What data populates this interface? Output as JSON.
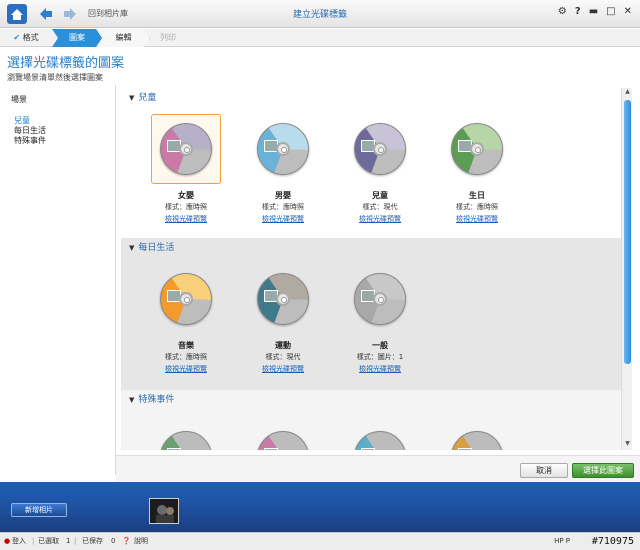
{
  "app": {
    "title": "建立光碟標籤",
    "back_label": "回到相片庫"
  },
  "top_icons": [
    {
      "name": "gear-icon",
      "glyph": "⚙"
    },
    {
      "name": "help-icon",
      "glyph": "?"
    },
    {
      "name": "minimize-icon",
      "glyph": "▬"
    },
    {
      "name": "maximize-icon",
      "glyph": "□"
    },
    {
      "name": "close-icon",
      "glyph": "✕"
    }
  ],
  "steps": {
    "format": "格式",
    "design": "圖案",
    "edit": "編輯",
    "print": "列印"
  },
  "heading": {
    "title": "選擇光碟標籤的圖案",
    "subtitle": "瀏覽場景清單然後選擇圖案"
  },
  "sidebar": {
    "section": "場景",
    "items": [
      "兒童",
      "每日生活",
      "特殊事件"
    ]
  },
  "groups": [
    {
      "title": "兒童",
      "cards": [
        {
          "name": "女嬰",
          "style": "樣式：應時照",
          "link": "檢視光碟預覽",
          "colors": [
            "#c97aa6",
            "#b6b0c8"
          ]
        },
        {
          "name": "男嬰",
          "style": "樣式：應時照",
          "link": "檢視光碟預覽",
          "colors": [
            "#6bb2d9",
            "#b8dcec"
          ]
        },
        {
          "name": "兒童",
          "style": "樣式：現代",
          "link": "檢視光碟預覽",
          "colors": [
            "#6e6a9c",
            "#c9c3d8"
          ]
        },
        {
          "name": "生日",
          "style": "樣式：應時照",
          "link": "檢視光碟預覽",
          "colors": [
            "#5c9c55",
            "#b6d6a8"
          ]
        }
      ]
    },
    {
      "title": "每日生活",
      "cards": [
        {
          "name": "音樂",
          "style": "樣式：應時照",
          "link": "檢視光碟預覽",
          "colors": [
            "#f39a2c",
            "#f8d07a"
          ]
        },
        {
          "name": "運動",
          "style": "樣式：現代",
          "link": "檢視光碟預覽",
          "colors": [
            "#3f7a8a",
            "#b0aaa0"
          ]
        },
        {
          "name": "一般",
          "style": "樣式：圖片：1",
          "link": "檢視光碟預覽",
          "colors": [
            "#a8a8a8",
            "#c8c8c8"
          ]
        }
      ]
    },
    {
      "title": "特殊事件",
      "cards": [
        {
          "colors": [
            "#6aa070",
            "#bcbcbc"
          ]
        },
        {
          "colors": [
            "#c97aa6",
            "#bcbcbc"
          ]
        },
        {
          "colors": [
            "#5bb0c8",
            "#bcbcbc"
          ]
        },
        {
          "colors": [
            "#d8a040",
            "#bcbcbc"
          ]
        }
      ]
    }
  ],
  "actions": {
    "cancel": "取消",
    "select": "選擇此圖案"
  },
  "tray": {
    "add_photos": "新增相片"
  },
  "status": {
    "login": "登入",
    "received": "已選取",
    "received_count": "1",
    "saved": "已保存",
    "saved_count": "0",
    "help": "說明",
    "brand": "HP P",
    "watermark": "#710975"
  },
  "colors": {
    "accent": "#2b90d9",
    "selected_border": "#f0a040",
    "primary_button": "#3e8f2e"
  }
}
